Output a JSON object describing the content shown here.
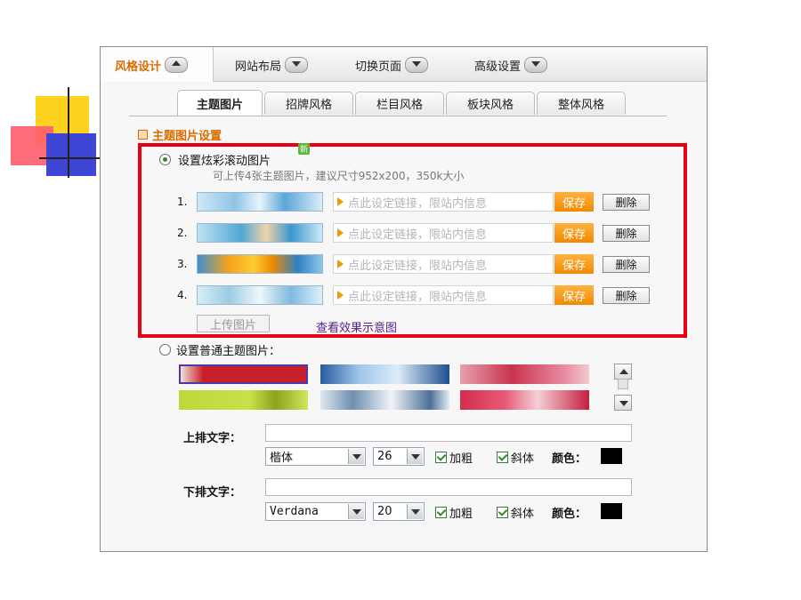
{
  "nav": {
    "items": [
      {
        "label": "风格设计"
      },
      {
        "label": "网站布局"
      },
      {
        "label": "切换页面"
      },
      {
        "label": "高级设置"
      }
    ]
  },
  "subtabs": [
    {
      "label": "主题图片"
    },
    {
      "label": "招牌风格"
    },
    {
      "label": "栏目风格"
    },
    {
      "label": "板块风格"
    },
    {
      "label": "整体风格"
    }
  ],
  "section_title": "主题图片设置",
  "rolling": {
    "option_label": "设置炫彩滚动图片",
    "new_badge": "新",
    "hint": "可上传4张主题图片，建议尺寸952x200，350k大小",
    "rows": [
      {
        "num": "1.",
        "placeholder": "点此设定链接，限站内信息",
        "save": "保存",
        "delete": "删除"
      },
      {
        "num": "2.",
        "placeholder": "点此设定链接，限站内信息",
        "save": "保存",
        "delete": "删除"
      },
      {
        "num": "3.",
        "placeholder": "点此设定链接，限站内信息",
        "save": "保存",
        "delete": "删除"
      },
      {
        "num": "4.",
        "placeholder": "点此设定链接，限站内信息",
        "save": "保存",
        "delete": "删除"
      }
    ],
    "upload_button": "上传图片",
    "preview_link": "查看效果示意图"
  },
  "normal": {
    "option_label": "设置普通主题图片："
  },
  "top_text": {
    "label": "上排文字：",
    "font": "楷体",
    "size": "26",
    "bold_label": "加粗",
    "italic_label": "斜体",
    "color_label": "颜色：",
    "color": "#000000"
  },
  "bottom_text": {
    "label": "下排文字：",
    "font": "Verdana",
    "size": "20",
    "bold_label": "加粗",
    "italic_label": "斜体",
    "color_label": "颜色：",
    "color": "#000000"
  },
  "colors": {
    "accent": "#d96b00",
    "highlight_border": "#e60012",
    "save_button": "#f08a00",
    "link": "#5a1f86"
  }
}
